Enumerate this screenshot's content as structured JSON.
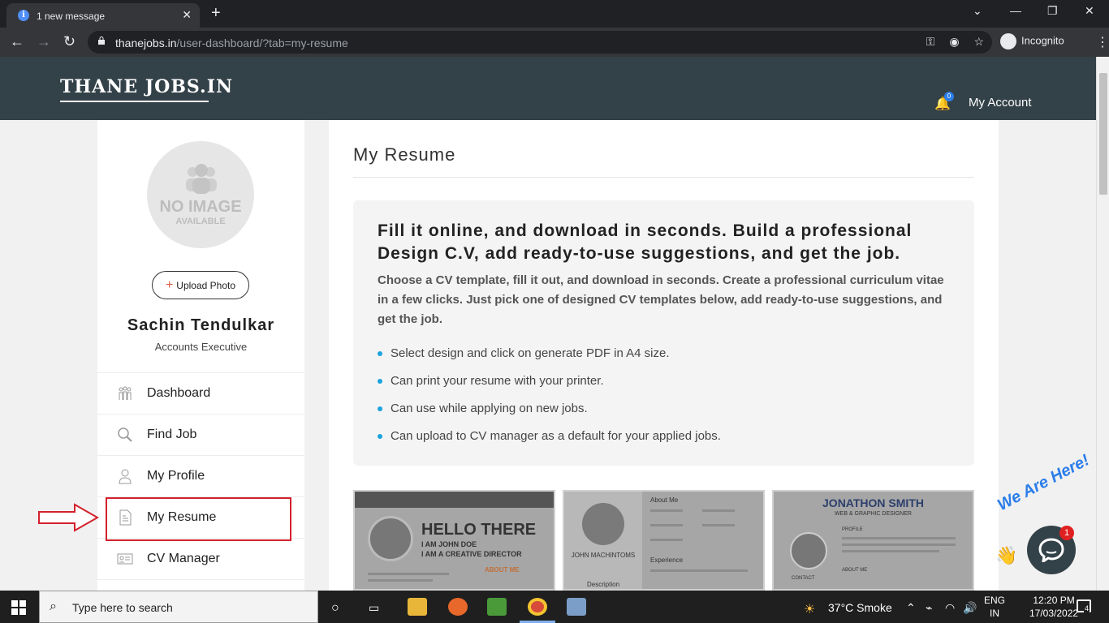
{
  "browser": {
    "tab_title": "1 new message",
    "tab_close": "✕",
    "new_tab": "+",
    "url_domain": "thanejobs.in",
    "url_path": "/user-dashboard/?tab=my-resume",
    "incognito_label": "Incognito",
    "window_controls": [
      "⌄",
      "—",
      "❐",
      "✕"
    ]
  },
  "header": {
    "logo_text": "THANE JOBS.IN",
    "notification_count": "0",
    "account_label": "My Account"
  },
  "sidebar": {
    "avatar_text": "NO IMAGE",
    "avatar_subtext": "AVAILABLE",
    "upload_label": "Upload Photo",
    "user_name": "Sachin Tendulkar",
    "user_role": "Accounts Executive",
    "items": [
      {
        "label": "Dashboard",
        "icon": "people-icon"
      },
      {
        "label": "Find Job",
        "icon": "search-icon"
      },
      {
        "label": "My Profile",
        "icon": "user-icon"
      },
      {
        "label": "My Resume",
        "icon": "document-icon"
      },
      {
        "label": "CV Manager",
        "icon": "id-card-icon"
      }
    ],
    "active_item": "My Resume",
    "highlight_color": "#d3212c"
  },
  "main": {
    "title": "My Resume",
    "heading": "Fill it online, and download in seconds. Build a professional Design C.V, add ready-to-use suggestions, and get the job.",
    "lead": "Choose a CV template, fill it out, and download in seconds. Create a professional curriculum vitae in a few clicks. Just pick one of designed CV templates below, add ready-to-use suggestions, and get the job.",
    "bullets": [
      "Select design and click on generate PDF in A4 size.",
      "Can print your resume with your printer.",
      "Can use while applying on new jobs.",
      "Can upload to CV manager as a default for your applied jobs."
    ],
    "templates": [
      {
        "headline": "HELLO THERE",
        "line1": "I AM JOHN DOE",
        "line2": "I AM A CREATIVE DIRECTOR",
        "section": "ABOUT ME"
      },
      {
        "name": "JOHN MACHINTOMS",
        "section1": "About Me",
        "section2": "Experience",
        "section3": "Description"
      },
      {
        "name": "JONATHON SMITH",
        "role": "WEB & GRAPHIC DESIGNER",
        "section1": "PROFILE",
        "section2": "ABOUT ME",
        "section3": "CONTACT"
      }
    ]
  },
  "chat": {
    "label": "We Are Here!",
    "badge": "1"
  },
  "taskbar": {
    "search_placeholder": "Type here to search",
    "weather": "37°C  Smoke",
    "lang_line1": "ENG",
    "lang_line2": "IN",
    "time": "12:20 PM",
    "date": "17/03/2022",
    "notifications": "4"
  },
  "colors": {
    "header_bg": "#334148",
    "accent_blue": "#1aa3dd",
    "chrome_bg": "#202124"
  }
}
